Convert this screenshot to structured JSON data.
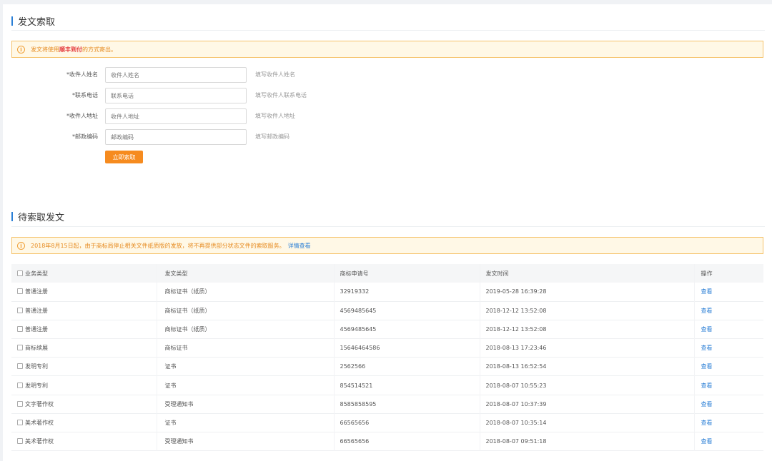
{
  "section1": {
    "title": "发文索取",
    "notice": {
      "prefix": "发文将使用",
      "highlight": "顺丰到付",
      "suffix": "的方式寄出。"
    },
    "fields": [
      {
        "label": "*收件人姓名",
        "placeholder": "收件人姓名",
        "hint": "填写收件人姓名"
      },
      {
        "label": "*联系电话",
        "placeholder": "联系电话",
        "hint": "填写收件人联系电话"
      },
      {
        "label": "*收件人地址",
        "placeholder": "收件人地址",
        "hint": "填写收件人地址"
      },
      {
        "label": "*邮政编码",
        "placeholder": "邮政编码",
        "hint": "填写邮政编码"
      }
    ],
    "submit_label": "立即索取"
  },
  "section2": {
    "title": "待索取发文",
    "notice": {
      "text": "2018年8月15日起，由于商标局停止相关文件纸质版的发放，将不再提供部分状态文件的索取服务。",
      "link": "详情查看"
    },
    "table": {
      "headers": [
        "业务类型",
        "发文类型",
        "商标申请号",
        "发文时间",
        "操作"
      ],
      "rows": [
        {
          "biz": "普通注册",
          "doc": "商标证书（纸质）",
          "no": "32919332",
          "time": "2019-05-28 16:39:28",
          "action": "查看"
        },
        {
          "biz": "普通注册",
          "doc": "商标证书（纸质）",
          "no": "4569485645",
          "time": "2018-12-12 13:52:08",
          "action": "查看"
        },
        {
          "biz": "普通注册",
          "doc": "商标证书（纸质）",
          "no": "4569485645",
          "time": "2018-12-12 13:52:08",
          "action": "查看"
        },
        {
          "biz": "商标续展",
          "doc": "商标证书",
          "no": "15646464586",
          "time": "2018-08-13 17:23:46",
          "action": "查看"
        },
        {
          "biz": "发明专利",
          "doc": "证书",
          "no": "2562566",
          "time": "2018-08-13 16:52:54",
          "action": "查看"
        },
        {
          "biz": "发明专利",
          "doc": "证书",
          "no": "854514521",
          "time": "2018-08-07 10:55:23",
          "action": "查看"
        },
        {
          "biz": "文字著作权",
          "doc": "受理通知书",
          "no": "8585858595",
          "time": "2018-08-07 10:37:39",
          "action": "查看"
        },
        {
          "biz": "美术著作权",
          "doc": "证书",
          "no": "66565656",
          "time": "2018-08-07 10:35:14",
          "action": "查看"
        },
        {
          "biz": "美术著作权",
          "doc": "受理通知书",
          "no": "66565656",
          "time": "2018-08-07 09:51:18",
          "action": "查看"
        }
      ]
    }
  }
}
